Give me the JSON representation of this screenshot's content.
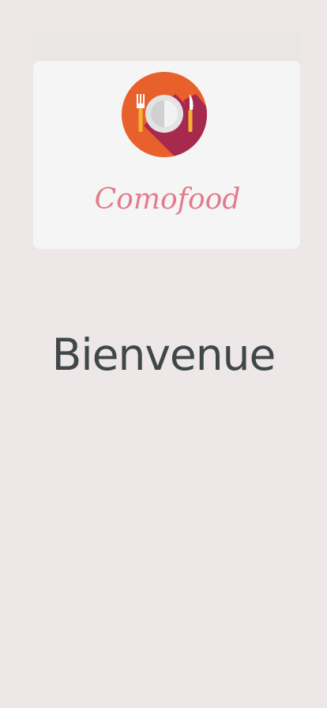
{
  "splash": {
    "logo": {
      "brand_name": "Comofood",
      "icon": "plate-fork-knife-icon",
      "colors": {
        "circle": "#e8602c",
        "shadow": "#a8294e",
        "fork": "#f2b632",
        "knife": "#f2b632",
        "script": "#e0707f"
      }
    },
    "welcome_text": "Bienvenue"
  },
  "colors": {
    "background": "#ede7e7",
    "card": "#f5f5f5",
    "title": "#3f4749"
  }
}
